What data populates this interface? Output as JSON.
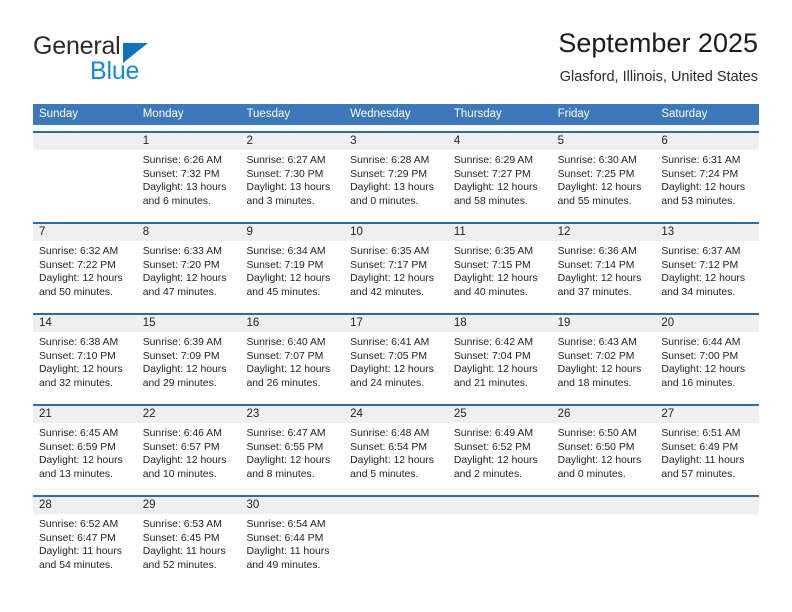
{
  "brand": {
    "name_part1": "General",
    "name_part2": "Blue",
    "logo_icon": "triangle-logo-icon"
  },
  "header": {
    "title": "September 2025",
    "location": "Glasford, Illinois, United States"
  },
  "colors": {
    "header_blue": "#3d78ba",
    "row_border_blue": "#2c6aad",
    "daynum_band": "#efefef",
    "brand_blue": "#1b87d4",
    "logo_blue": "#1173bd"
  },
  "weekdays": [
    "Sunday",
    "Monday",
    "Tuesday",
    "Wednesday",
    "Thursday",
    "Friday",
    "Saturday"
  ],
  "weeks": [
    {
      "numbers": [
        "",
        "1",
        "2",
        "3",
        "4",
        "5",
        "6"
      ],
      "days": [
        {
          "empty": true,
          "sunrise": "",
          "sunset": "",
          "daylight_line1": "",
          "daylight_line2": ""
        },
        {
          "empty": false,
          "sunrise": "Sunrise: 6:26 AM",
          "sunset": "Sunset: 7:32 PM",
          "daylight_line1": "Daylight: 13 hours",
          "daylight_line2": "and 6 minutes."
        },
        {
          "empty": false,
          "sunrise": "Sunrise: 6:27 AM",
          "sunset": "Sunset: 7:30 PM",
          "daylight_line1": "Daylight: 13 hours",
          "daylight_line2": "and 3 minutes."
        },
        {
          "empty": false,
          "sunrise": "Sunrise: 6:28 AM",
          "sunset": "Sunset: 7:29 PM",
          "daylight_line1": "Daylight: 13 hours",
          "daylight_line2": "and 0 minutes."
        },
        {
          "empty": false,
          "sunrise": "Sunrise: 6:29 AM",
          "sunset": "Sunset: 7:27 PM",
          "daylight_line1": "Daylight: 12 hours",
          "daylight_line2": "and 58 minutes."
        },
        {
          "empty": false,
          "sunrise": "Sunrise: 6:30 AM",
          "sunset": "Sunset: 7:25 PM",
          "daylight_line1": "Daylight: 12 hours",
          "daylight_line2": "and 55 minutes."
        },
        {
          "empty": false,
          "sunrise": "Sunrise: 6:31 AM",
          "sunset": "Sunset: 7:24 PM",
          "daylight_line1": "Daylight: 12 hours",
          "daylight_line2": "and 53 minutes."
        }
      ]
    },
    {
      "numbers": [
        "7",
        "8",
        "9",
        "10",
        "11",
        "12",
        "13"
      ],
      "days": [
        {
          "empty": false,
          "sunrise": "Sunrise: 6:32 AM",
          "sunset": "Sunset: 7:22 PM",
          "daylight_line1": "Daylight: 12 hours",
          "daylight_line2": "and 50 minutes."
        },
        {
          "empty": false,
          "sunrise": "Sunrise: 6:33 AM",
          "sunset": "Sunset: 7:20 PM",
          "daylight_line1": "Daylight: 12 hours",
          "daylight_line2": "and 47 minutes."
        },
        {
          "empty": false,
          "sunrise": "Sunrise: 6:34 AM",
          "sunset": "Sunset: 7:19 PM",
          "daylight_line1": "Daylight: 12 hours",
          "daylight_line2": "and 45 minutes."
        },
        {
          "empty": false,
          "sunrise": "Sunrise: 6:35 AM",
          "sunset": "Sunset: 7:17 PM",
          "daylight_line1": "Daylight: 12 hours",
          "daylight_line2": "and 42 minutes."
        },
        {
          "empty": false,
          "sunrise": "Sunrise: 6:35 AM",
          "sunset": "Sunset: 7:15 PM",
          "daylight_line1": "Daylight: 12 hours",
          "daylight_line2": "and 40 minutes."
        },
        {
          "empty": false,
          "sunrise": "Sunrise: 6:36 AM",
          "sunset": "Sunset: 7:14 PM",
          "daylight_line1": "Daylight: 12 hours",
          "daylight_line2": "and 37 minutes."
        },
        {
          "empty": false,
          "sunrise": "Sunrise: 6:37 AM",
          "sunset": "Sunset: 7:12 PM",
          "daylight_line1": "Daylight: 12 hours",
          "daylight_line2": "and 34 minutes."
        }
      ]
    },
    {
      "numbers": [
        "14",
        "15",
        "16",
        "17",
        "18",
        "19",
        "20"
      ],
      "days": [
        {
          "empty": false,
          "sunrise": "Sunrise: 6:38 AM",
          "sunset": "Sunset: 7:10 PM",
          "daylight_line1": "Daylight: 12 hours",
          "daylight_line2": "and 32 minutes."
        },
        {
          "empty": false,
          "sunrise": "Sunrise: 6:39 AM",
          "sunset": "Sunset: 7:09 PM",
          "daylight_line1": "Daylight: 12 hours",
          "daylight_line2": "and 29 minutes."
        },
        {
          "empty": false,
          "sunrise": "Sunrise: 6:40 AM",
          "sunset": "Sunset: 7:07 PM",
          "daylight_line1": "Daylight: 12 hours",
          "daylight_line2": "and 26 minutes."
        },
        {
          "empty": false,
          "sunrise": "Sunrise: 6:41 AM",
          "sunset": "Sunset: 7:05 PM",
          "daylight_line1": "Daylight: 12 hours",
          "daylight_line2": "and 24 minutes."
        },
        {
          "empty": false,
          "sunrise": "Sunrise: 6:42 AM",
          "sunset": "Sunset: 7:04 PM",
          "daylight_line1": "Daylight: 12 hours",
          "daylight_line2": "and 21 minutes."
        },
        {
          "empty": false,
          "sunrise": "Sunrise: 6:43 AM",
          "sunset": "Sunset: 7:02 PM",
          "daylight_line1": "Daylight: 12 hours",
          "daylight_line2": "and 18 minutes."
        },
        {
          "empty": false,
          "sunrise": "Sunrise: 6:44 AM",
          "sunset": "Sunset: 7:00 PM",
          "daylight_line1": "Daylight: 12 hours",
          "daylight_line2": "and 16 minutes."
        }
      ]
    },
    {
      "numbers": [
        "21",
        "22",
        "23",
        "24",
        "25",
        "26",
        "27"
      ],
      "days": [
        {
          "empty": false,
          "sunrise": "Sunrise: 6:45 AM",
          "sunset": "Sunset: 6:59 PM",
          "daylight_line1": "Daylight: 12 hours",
          "daylight_line2": "and 13 minutes."
        },
        {
          "empty": false,
          "sunrise": "Sunrise: 6:46 AM",
          "sunset": "Sunset: 6:57 PM",
          "daylight_line1": "Daylight: 12 hours",
          "daylight_line2": "and 10 minutes."
        },
        {
          "empty": false,
          "sunrise": "Sunrise: 6:47 AM",
          "sunset": "Sunset: 6:55 PM",
          "daylight_line1": "Daylight: 12 hours",
          "daylight_line2": "and 8 minutes."
        },
        {
          "empty": false,
          "sunrise": "Sunrise: 6:48 AM",
          "sunset": "Sunset: 6:54 PM",
          "daylight_line1": "Daylight: 12 hours",
          "daylight_line2": "and 5 minutes."
        },
        {
          "empty": false,
          "sunrise": "Sunrise: 6:49 AM",
          "sunset": "Sunset: 6:52 PM",
          "daylight_line1": "Daylight: 12 hours",
          "daylight_line2": "and 2 minutes."
        },
        {
          "empty": false,
          "sunrise": "Sunrise: 6:50 AM",
          "sunset": "Sunset: 6:50 PM",
          "daylight_line1": "Daylight: 12 hours",
          "daylight_line2": "and 0 minutes."
        },
        {
          "empty": false,
          "sunrise": "Sunrise: 6:51 AM",
          "sunset": "Sunset: 6:49 PM",
          "daylight_line1": "Daylight: 11 hours",
          "daylight_line2": "and 57 minutes."
        }
      ]
    },
    {
      "numbers": [
        "28",
        "29",
        "30",
        "",
        "",
        "",
        ""
      ],
      "days": [
        {
          "empty": false,
          "sunrise": "Sunrise: 6:52 AM",
          "sunset": "Sunset: 6:47 PM",
          "daylight_line1": "Daylight: 11 hours",
          "daylight_line2": "and 54 minutes."
        },
        {
          "empty": false,
          "sunrise": "Sunrise: 6:53 AM",
          "sunset": "Sunset: 6:45 PM",
          "daylight_line1": "Daylight: 11 hours",
          "daylight_line2": "and 52 minutes."
        },
        {
          "empty": false,
          "sunrise": "Sunrise: 6:54 AM",
          "sunset": "Sunset: 6:44 PM",
          "daylight_line1": "Daylight: 11 hours",
          "daylight_line2": "and 49 minutes."
        },
        {
          "empty": true,
          "sunrise": "",
          "sunset": "",
          "daylight_line1": "",
          "daylight_line2": ""
        },
        {
          "empty": true,
          "sunrise": "",
          "sunset": "",
          "daylight_line1": "",
          "daylight_line2": ""
        },
        {
          "empty": true,
          "sunrise": "",
          "sunset": "",
          "daylight_line1": "",
          "daylight_line2": ""
        },
        {
          "empty": true,
          "sunrise": "",
          "sunset": "",
          "daylight_line1": "",
          "daylight_line2": ""
        }
      ]
    }
  ]
}
